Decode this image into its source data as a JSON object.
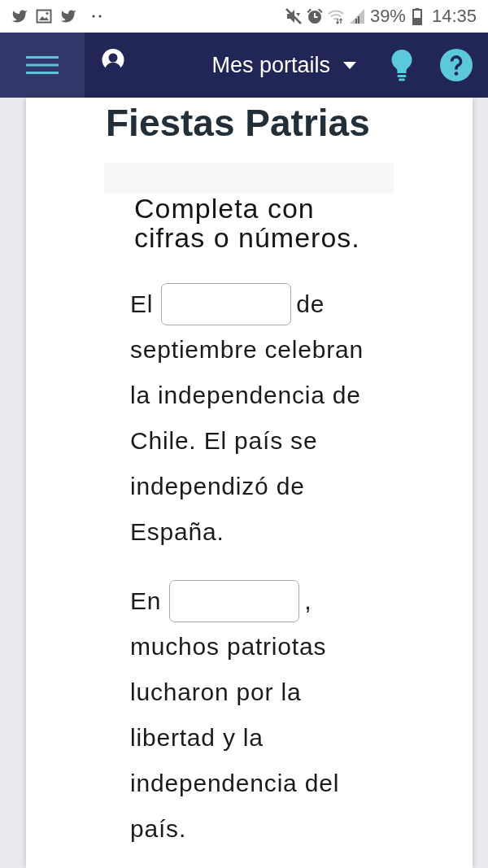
{
  "status_bar": {
    "battery": "39%",
    "time": "14:35"
  },
  "nav_bar": {
    "portal_menu": {
      "label": "Mes portails"
    }
  },
  "exercise": {
    "title": "Fiestas Patrias",
    "instruction": "Completa con cifras o números.",
    "items": [
      {
        "before": "El",
        "after": "de",
        "continuation": "septiembre celebran la independencia de Chile. El país se independizó de España."
      },
      {
        "before": "En",
        "after": ",",
        "continuation": "muchos patriotas lucharon por la libertad y la independencia del país."
      }
    ]
  }
}
